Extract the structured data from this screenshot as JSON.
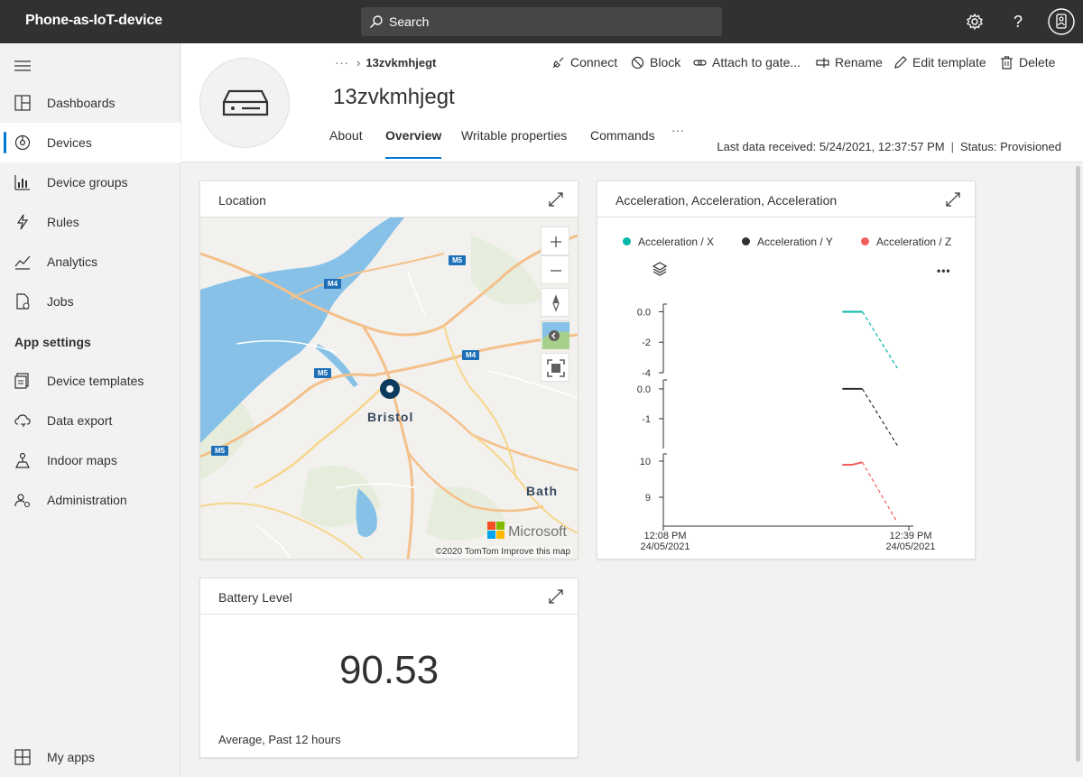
{
  "app": {
    "title": "Phone-as-IoT-device"
  },
  "search": {
    "label": "Search"
  },
  "topbar": {
    "icons": [
      "gear-icon",
      "help-icon",
      "user-avatar-icon"
    ]
  },
  "sidebar": {
    "items": [
      {
        "label": "Dashboards",
        "icon": "dashboard-icon"
      },
      {
        "label": "Devices",
        "icon": "devices-icon",
        "active": true
      },
      {
        "label": "Device groups",
        "icon": "device-groups-icon"
      },
      {
        "label": "Rules",
        "icon": "rules-icon"
      },
      {
        "label": "Analytics",
        "icon": "analytics-icon"
      },
      {
        "label": "Jobs",
        "icon": "jobs-icon"
      }
    ],
    "section_title": "App settings",
    "settings_items": [
      {
        "label": "Device templates",
        "icon": "device-templates-icon"
      },
      {
        "label": "Data export",
        "icon": "data-export-icon"
      },
      {
        "label": "Indoor maps",
        "icon": "indoor-maps-icon"
      },
      {
        "label": "Administration",
        "icon": "administration-icon"
      }
    ],
    "bottom_item": {
      "label": "My apps",
      "icon": "apps-icon"
    }
  },
  "breadcrumb": {
    "ellipsis": "···",
    "current": "13zvkmhjegt"
  },
  "device": {
    "name": "13zvkmhjegt"
  },
  "tabs": [
    "About",
    "Overview",
    "Writable properties",
    "Commands",
    "···"
  ],
  "commands": [
    "Connect",
    "Block",
    "Attach to gate...",
    "Rename",
    "Edit template",
    "Delete"
  ],
  "status": {
    "last_data": "Last data received: 5/24/2021, 12:37:57 PM",
    "separator": "|",
    "provisioned": "Status: Provisioned"
  },
  "location_card": {
    "title": "Location",
    "cities": [
      "Bristol",
      "Bath"
    ],
    "roads": [
      "M5",
      "M4",
      "M4",
      "M5",
      "M5"
    ],
    "logo": "Microsoft",
    "credit": "©2020 TomTom  Improve this map"
  },
  "accel_card": {
    "title": "Acceleration, Acceleration, Acceleration",
    "legend": [
      {
        "name": "Acceleration / X",
        "color": "#00b7a8"
      },
      {
        "name": "Acceleration / Y",
        "color": "#323130"
      },
      {
        "name": "Acceleration / Z",
        "color": "#f05e5e"
      }
    ],
    "more": "•••"
  },
  "battery_card": {
    "title": "Battery Level",
    "value": "90.53",
    "footer": "Average, Past 12 hours"
  },
  "chart_data": {
    "type": "line",
    "x_ticks": [
      {
        "time": "12:08 PM",
        "date": "24/05/2021"
      },
      {
        "time": "12:39 PM",
        "date": "24/05/2021"
      }
    ],
    "series": [
      {
        "name": "Acceleration / X",
        "color": "#00b7a8",
        "y_ticks": [
          "0.0",
          "-2",
          "-4"
        ],
        "ylim": [
          -4,
          0.5
        ],
        "points": [
          [
            0.68,
            0.0
          ],
          [
            0.76,
            0.0
          ],
          [
            0.9,
            -3.7
          ]
        ]
      },
      {
        "name": "Acceleration / Y",
        "color": "#323130",
        "y_ticks": [
          "0.0",
          "-1"
        ],
        "ylim": [
          -2.0,
          0.3
        ],
        "points": [
          [
            0.68,
            0.0
          ],
          [
            0.76,
            0.0
          ],
          [
            0.9,
            -1.9
          ]
        ]
      },
      {
        "name": "Acceleration / Z",
        "color": "#f05e5e",
        "y_ticks": [
          "10",
          "9"
        ],
        "ylim": [
          8.2,
          10.2
        ],
        "points": [
          [
            0.68,
            9.9
          ],
          [
            0.72,
            9.9
          ],
          [
            0.76,
            9.97
          ],
          [
            0.9,
            8.3
          ]
        ]
      }
    ]
  }
}
